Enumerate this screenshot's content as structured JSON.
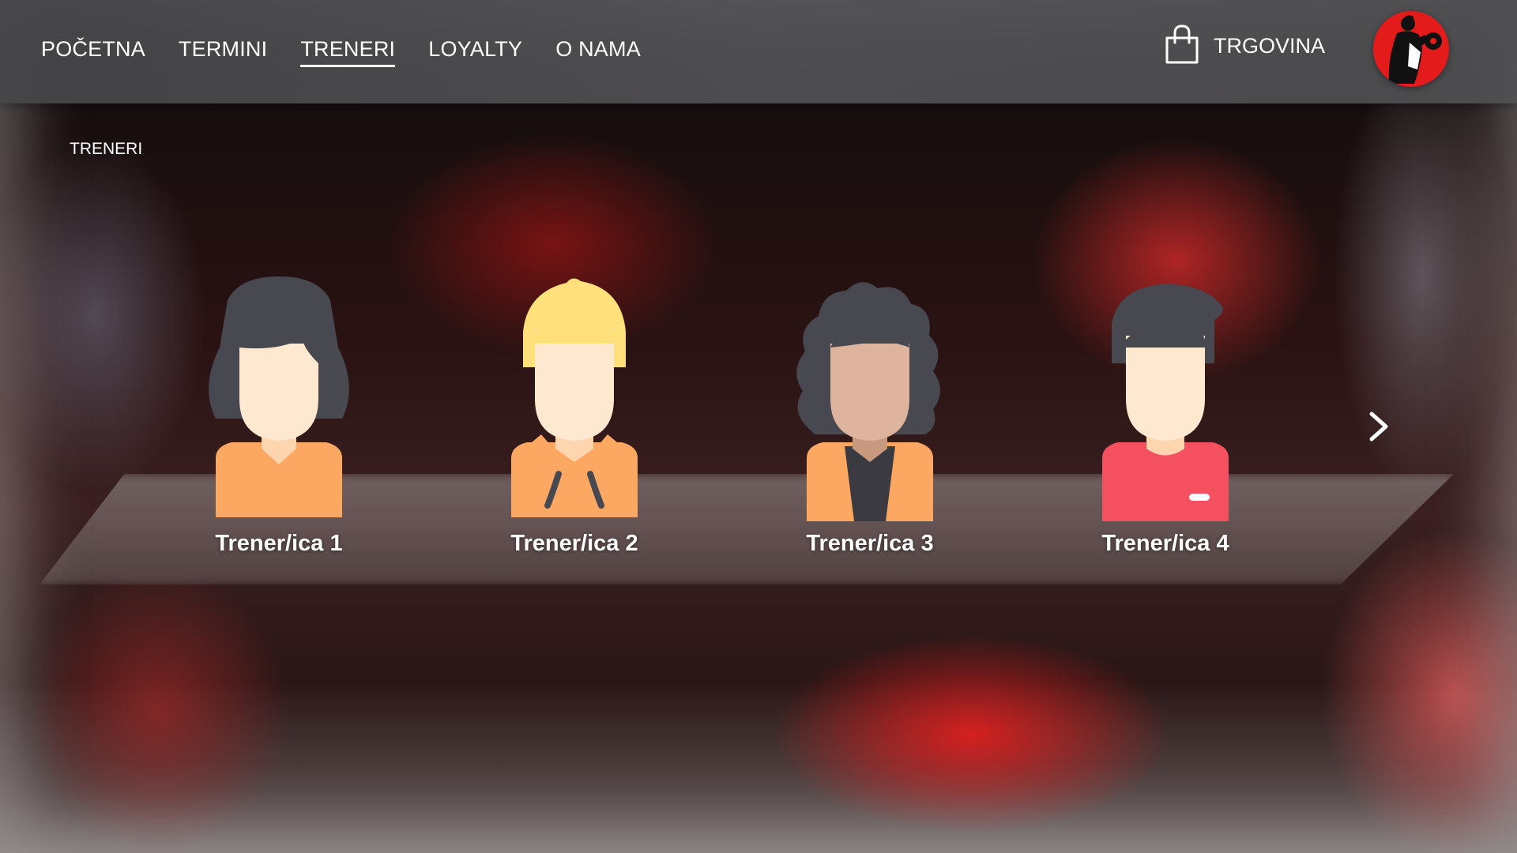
{
  "nav": {
    "items": [
      {
        "label": "POČETNA",
        "active": false
      },
      {
        "label": "TERMINI",
        "active": false
      },
      {
        "label": "TRENERI",
        "active": true
      },
      {
        "label": "LOYALTY",
        "active": false
      },
      {
        "label": "O NAMA",
        "active": false
      }
    ],
    "shop_label": "TRGOVINA",
    "shop_icon": "shopping-bag-icon",
    "logo_icon": "gym-logo-icon"
  },
  "breadcrumb": "TRENERI",
  "trainers": [
    {
      "name": "Trener/ica 1",
      "avatar": "female-long-hair-avatar"
    },
    {
      "name": "Trener/ica 2",
      "avatar": "male-blonde-avatar"
    },
    {
      "name": "Trener/ica 3",
      "avatar": "female-curly-hair-avatar"
    },
    {
      "name": "Trener/ica 4",
      "avatar": "male-dark-hair-avatar"
    }
  ],
  "carousel": {
    "next_icon": "chevron-right-icon"
  },
  "colors": {
    "accent_red": "#e31b1b",
    "nav_text": "#ffffff",
    "shirt_orange": "#fca862",
    "shirt_red": "#f4505f",
    "hair_dark": "#474850",
    "hair_blonde": "#ffe07a",
    "skin_light": "#ffe8d0",
    "skin_tan": "#dfb49f"
  }
}
